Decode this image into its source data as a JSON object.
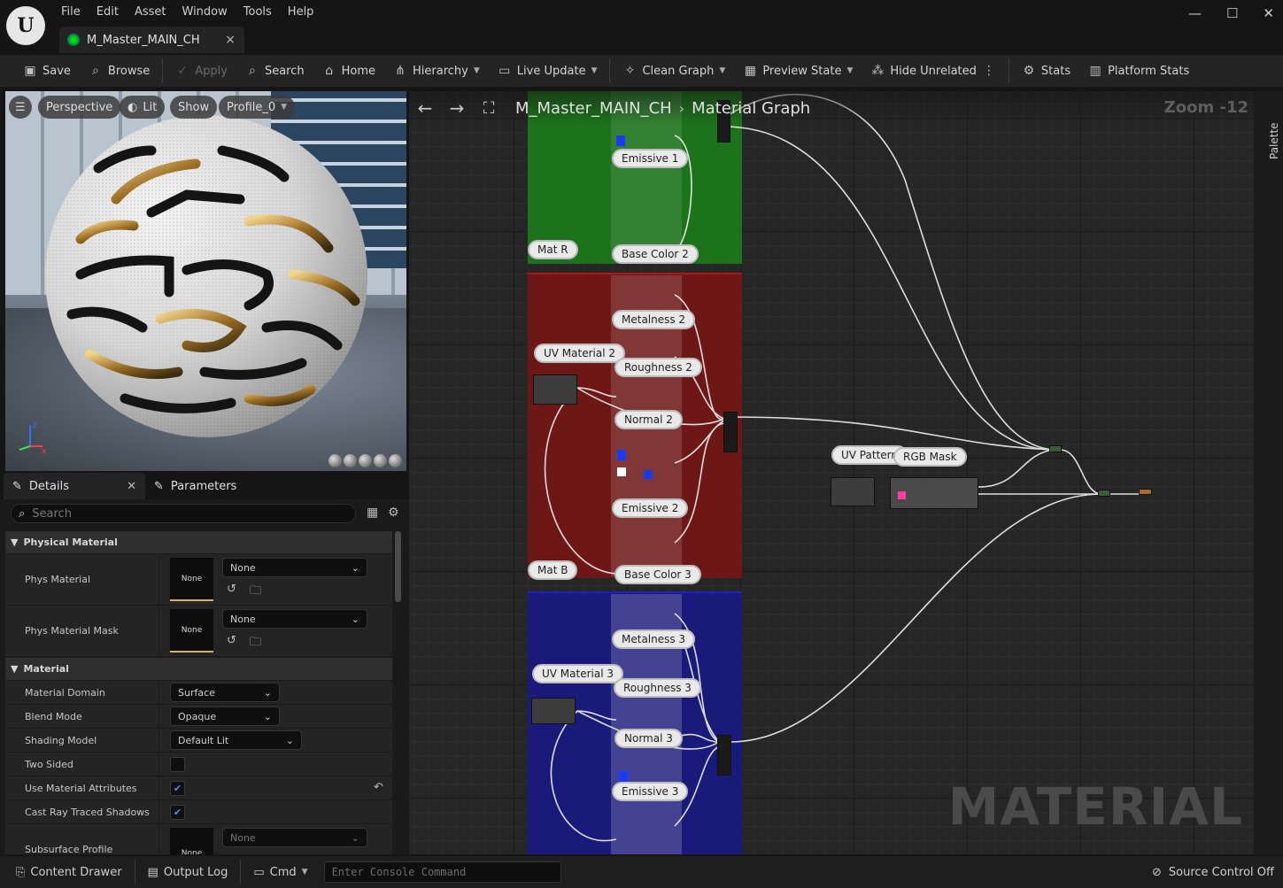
{
  "menu": [
    "File",
    "Edit",
    "Asset",
    "Window",
    "Tools",
    "Help"
  ],
  "document_tab": {
    "title": "M_Master_MAIN_CH",
    "close": "×"
  },
  "window_controls": {
    "minimize": "—",
    "maximize": "☐",
    "close": "✕"
  },
  "toolbar": {
    "save": "Save",
    "browse": "Browse",
    "apply": "Apply",
    "search": "Search",
    "home": "Home",
    "hierarchy": "Hierarchy",
    "live_update": "Live Update",
    "clean_graph": "Clean Graph",
    "preview_state": "Preview State",
    "hide_unrelated": "Hide Unrelated",
    "stats": "Stats",
    "platform_stats": "Platform Stats"
  },
  "viewport": {
    "perspective": "Perspective",
    "lit": "Lit",
    "show": "Show",
    "profile": "Profile_0"
  },
  "details_tabs": {
    "details": "Details",
    "parameters": "Parameters"
  },
  "details": {
    "search_placeholder": "Search",
    "cat_physical": "Physical Material",
    "phys_material": {
      "label": "Phys Material",
      "thumb": "None",
      "value": "None"
    },
    "phys_material_mask": {
      "label": "Phys Material Mask",
      "thumb": "None",
      "value": "None"
    },
    "cat_material": "Material",
    "material_domain": {
      "label": "Material Domain",
      "value": "Surface"
    },
    "blend_mode": {
      "label": "Blend Mode",
      "value": "Opaque"
    },
    "shading_model": {
      "label": "Shading Model",
      "value": "Default Lit"
    },
    "two_sided": {
      "label": "Two Sided",
      "checked": false
    },
    "use_material_attributes": {
      "label": "Use Material Attributes",
      "checked": true
    },
    "cast_ray_traced_shadows": {
      "label": "Cast Ray Traced Shadows",
      "checked": true
    },
    "subsurface_profile": {
      "label": "Subsurface Profile",
      "thumb": "None",
      "value": "None"
    }
  },
  "graph": {
    "breadcrumb_asset": "M_Master_MAIN_CH",
    "breadcrumb_view": "Material Graph",
    "zoom": "Zoom -12",
    "watermark": "MATERIAL",
    "comments": {
      "mat_r": "Mat R",
      "base_color_2": "Base Color 2",
      "metalness_2": "Metalness 2",
      "uv_material_2": "UV Material 2",
      "roughness_2": "Roughness 2",
      "normal_2": "Normal 2",
      "emissive_2": "Emissive 2",
      "mat_b": "Mat B",
      "base_color_3": "Base Color 3",
      "metalness_3": "Metalness 3",
      "uv_material_3": "UV Material 3",
      "roughness_3": "Roughness 3",
      "normal_3": "Normal 3",
      "emissive_3": "Emissive 3",
      "emissive_1": "Emissive 1",
      "uv_pattern": "UV Pattern",
      "rgb_mask": "RGB Mask"
    },
    "colors": {
      "green": "#1e7a1e",
      "red": "#7a1818",
      "blue": "#1a1a80"
    }
  },
  "palette_label": "Palette",
  "statusbar": {
    "content_drawer": "Content Drawer",
    "output_log": "Output Log",
    "cmd": "Cmd",
    "console_placeholder": "Enter Console Command",
    "source_control": "Source Control Off"
  }
}
